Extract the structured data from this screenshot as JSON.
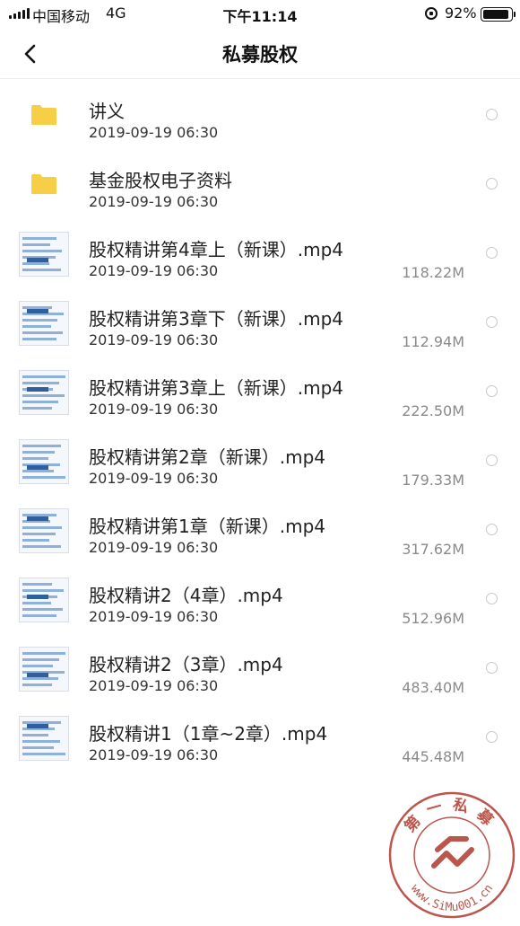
{
  "status_bar": {
    "carrier": "中国移动",
    "network": "4G",
    "time": "下午11:14",
    "battery_percent": "92%"
  },
  "nav": {
    "title": "私募股权",
    "back_icon": "chevron-left-icon"
  },
  "files": [
    {
      "type": "folder",
      "name": "讲义",
      "date": "2019-09-19 06:30",
      "size": ""
    },
    {
      "type": "folder",
      "name": "基金股权电子资料",
      "date": "2019-09-19 06:30",
      "size": ""
    },
    {
      "type": "video",
      "name": "股权精讲第4章上（新课）.mp4",
      "date": "2019-09-19 06:30",
      "size": "118.22M"
    },
    {
      "type": "video",
      "name": "股权精讲第3章下（新课）.mp4",
      "date": "2019-09-19 06:30",
      "size": "112.94M"
    },
    {
      "type": "video",
      "name": "股权精讲第3章上（新课）.mp4",
      "date": "2019-09-19 06:30",
      "size": "222.50M"
    },
    {
      "type": "video",
      "name": "股权精讲第2章（新课）.mp4",
      "date": "2019-09-19 06:30",
      "size": "179.33M"
    },
    {
      "type": "video",
      "name": "股权精讲第1章（新课）.mp4",
      "date": "2019-09-19 06:30",
      "size": "317.62M"
    },
    {
      "type": "video",
      "name": "股权精讲2（4章）.mp4",
      "date": "2019-09-19 06:30",
      "size": "512.96M"
    },
    {
      "type": "video",
      "name": "股权精讲2（3章）.mp4",
      "date": "2019-09-19 06:30",
      "size": "483.40M"
    },
    {
      "type": "video",
      "name": "股权精讲1（1章~2章）.mp4",
      "date": "2019-09-19 06:30",
      "size": "445.48M"
    }
  ],
  "watermark": {
    "top_text": "第一私募",
    "bottom_text": "www.SiMu001.cn"
  },
  "colors": {
    "folder": "#f7cf46",
    "radio_border": "#c8c8c8",
    "seal": "#c0392b"
  }
}
